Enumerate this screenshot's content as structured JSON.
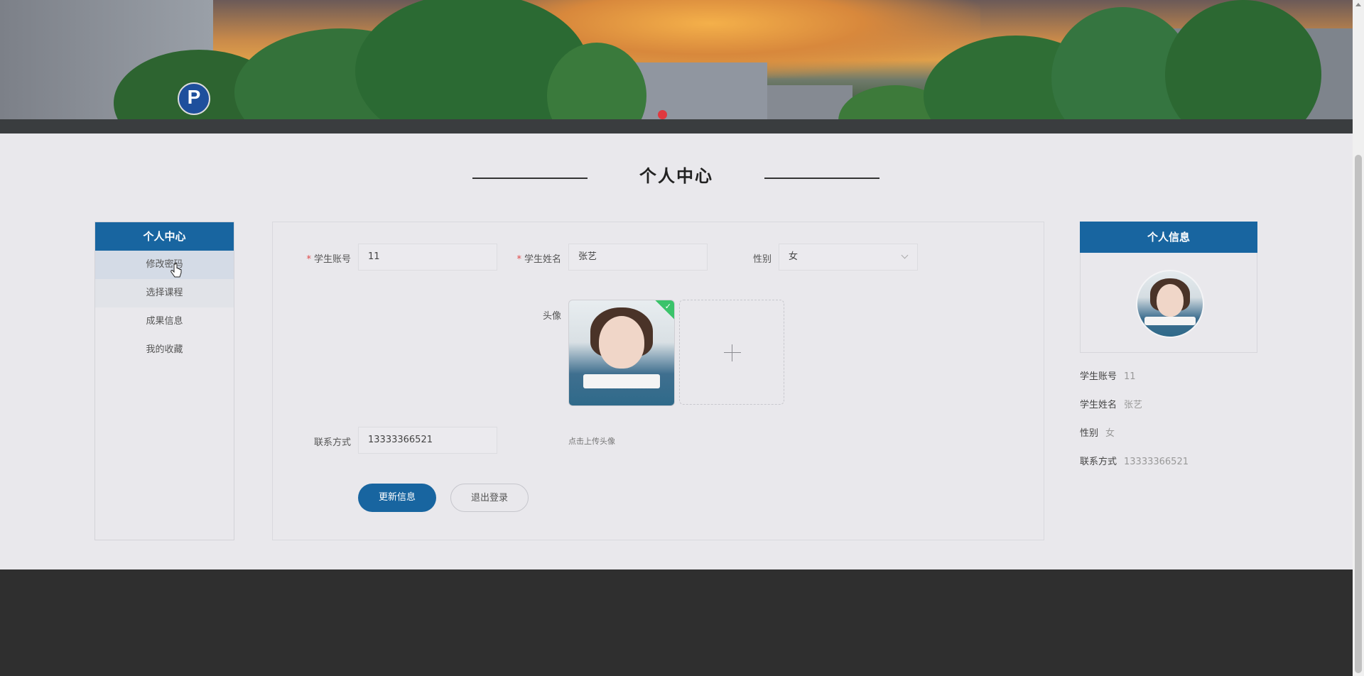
{
  "page": {
    "title": "个人中心"
  },
  "side_menu": {
    "header": "个人中心",
    "items": [
      {
        "label": "修改密码"
      },
      {
        "label": "选择课程"
      },
      {
        "label": "成果信息"
      },
      {
        "label": "我的收藏"
      }
    ]
  },
  "form": {
    "account": {
      "label": "学生账号",
      "value": "11",
      "required": true
    },
    "name": {
      "label": "学生姓名",
      "value": "张艺",
      "required": true
    },
    "gender": {
      "label": "性别",
      "value": "女"
    },
    "avatar": {
      "label": "头像",
      "hint": "点击上传头像"
    },
    "phone": {
      "label": "联系方式",
      "value": "13333366521"
    },
    "update_button": "更新信息",
    "logout_button": "退出登录"
  },
  "info_panel": {
    "header": "个人信息",
    "rows": [
      {
        "label": "学生账号",
        "value": "11"
      },
      {
        "label": "学生姓名",
        "value": "张艺"
      },
      {
        "label": "性别",
        "value": "女"
      },
      {
        "label": "联系方式",
        "value": "13333366521"
      }
    ]
  },
  "colors": {
    "primary": "#1865a0",
    "required": "#e04a4a",
    "footer": "#2f2f2f"
  },
  "icons": {
    "upload": "plus-icon",
    "dropdown": "chevron-down-icon",
    "success": "check-icon"
  }
}
